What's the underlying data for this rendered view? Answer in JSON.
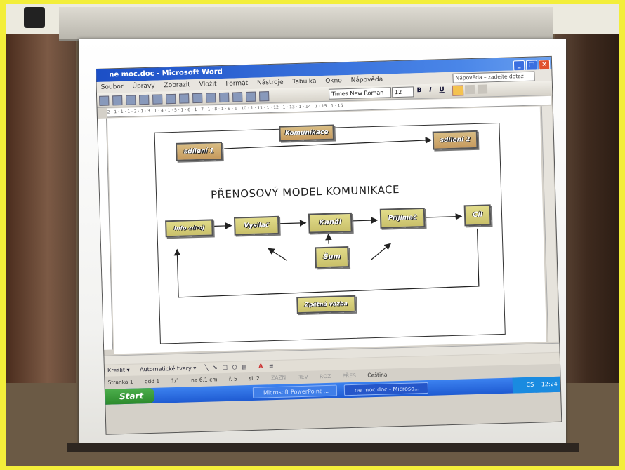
{
  "window": {
    "title": "ne moc.doc - Microsoft Word",
    "buttons": [
      "_",
      "□",
      "×"
    ]
  },
  "menu": [
    "Soubor",
    "Úpravy",
    "Zobrazit",
    "Vložit",
    "Formát",
    "Nástroje",
    "Tabulka",
    "Okno",
    "Nápověda"
  ],
  "help_box": "Nápověda – zadejte dotaz",
  "toolbar": {
    "font": "Times New Roman",
    "size": "12",
    "bold": "B",
    "italic": "I",
    "underline": "U"
  },
  "ruler_text": "2 · 1 · 1 · 1 · 2 · 1 · 3 · 1 · 4 · 1 · 5 · 1 · 6 · 1 · 7 · 1 · 8 · 1 · 9 · 1 · 10 · 1 · 11 · 1 · 12 · 1 · 13 · 1 · 14 · 1 · 15 · 1 · 16",
  "diagram": {
    "title": "PŘENOSOVÝ MODEL KOMUNIKACE",
    "top_left": "sdílení 1",
    "top_mid": "Komunikace",
    "top_right": "sdílení 2",
    "source": "Info zdroj",
    "transmitter": "Vysílač",
    "channel": "Kanál",
    "receiver": "Přijímač",
    "goal": "Cíl",
    "noise": "Šum",
    "feedback": "Zpětná vazba"
  },
  "drawing_bar": {
    "draw": "Kreslit ▾",
    "autoshapes": "Automatické tvary ▾"
  },
  "status": {
    "page": "Stránka 1",
    "section": "odd 1",
    "pages": "1/1",
    "at": "na 6,1 cm",
    "line": "ř. 5",
    "col": "sl. 2",
    "rec": "ZÁZN",
    "rev": "REV",
    "ext": "ROZ",
    "ovr": "PŘES",
    "lang": "Čeština"
  },
  "taskbar": {
    "start": "Start",
    "tasks": [
      "Microsoft PowerPoint ...",
      "ne moc.doc - Microso..."
    ],
    "lang": "CS",
    "clock": "12:24"
  }
}
